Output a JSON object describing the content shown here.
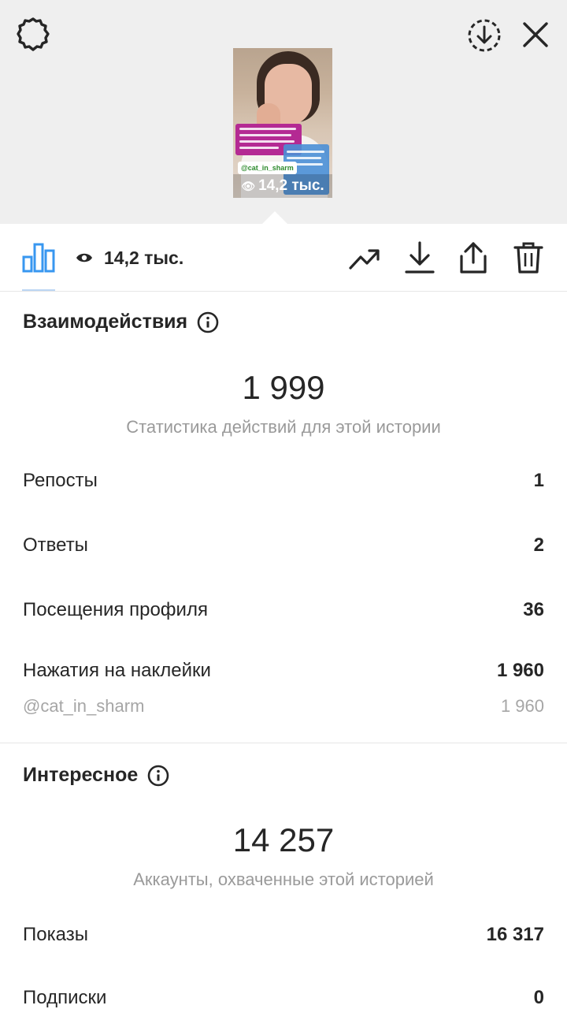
{
  "preview": {
    "mention": "@cat_in_sharm",
    "views": "14,2 тыс."
  },
  "toolbar": {
    "views": "14,2 тыс."
  },
  "interactions": {
    "title": "Взаимодействия",
    "total": "1 999",
    "subtitle": "Статистика действий для этой истории",
    "rows": [
      {
        "label": "Репосты",
        "value": "1"
      },
      {
        "label": "Ответы",
        "value": "2"
      },
      {
        "label": "Посещения профиля",
        "value": "36"
      },
      {
        "label": "Нажатия на наклейки",
        "value": "1 960"
      }
    ],
    "sticker_detail": {
      "label": "@cat_in_sharm",
      "value": "1 960"
    }
  },
  "discovery": {
    "title": "Интересное",
    "total": "14 257",
    "subtitle": "Аккаунты, охваченные этой историей",
    "rows": [
      {
        "label": "Показы",
        "value": "16 317"
      },
      {
        "label": "Подписки",
        "value": "0"
      }
    ]
  },
  "colors": {
    "accent": "#3897f0",
    "text": "#262626",
    "muted": "#9a9a9a"
  }
}
